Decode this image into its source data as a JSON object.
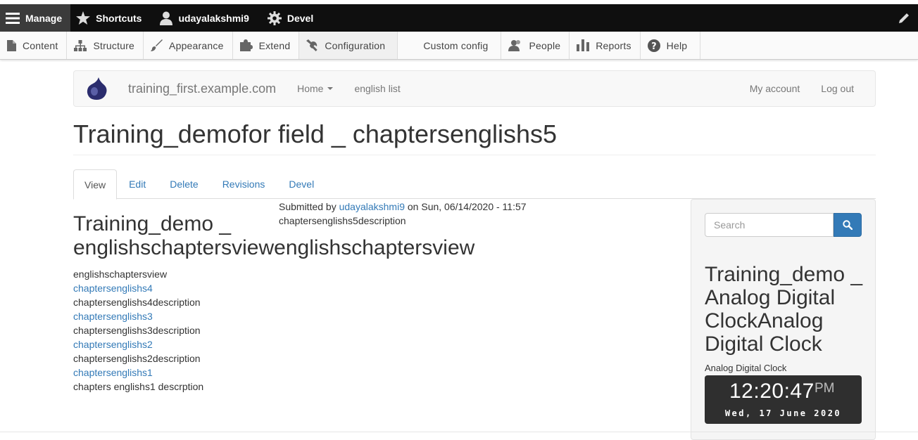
{
  "admin_toolbar": {
    "manage": "Manage",
    "shortcuts": "Shortcuts",
    "user": "udayalakshmi9",
    "devel": "Devel"
  },
  "admin_tray": [
    {
      "label": "Content",
      "icon": "file-icon"
    },
    {
      "label": "Structure",
      "icon": "sitemap-icon"
    },
    {
      "label": "Appearance",
      "icon": "paintbrush-icon"
    },
    {
      "label": "Extend",
      "icon": "puzzle-icon"
    },
    {
      "label": "Configuration",
      "icon": "wrench-icon"
    },
    {
      "label": "Custom config",
      "icon": ""
    },
    {
      "label": "People",
      "icon": "people-icon"
    },
    {
      "label": "Reports",
      "icon": "bar-chart-icon"
    },
    {
      "label": "Help",
      "icon": "help-icon"
    }
  ],
  "site_nav": {
    "site_name": "training_first.example.com",
    "home": "Home",
    "english_list": "english list",
    "my_account": "My account",
    "log_out": "Log out"
  },
  "page": {
    "title": "Training_demofor field _ chaptersenglishs5",
    "tabs": [
      "View",
      "Edit",
      "Delete",
      "Revisions",
      "Devel"
    ]
  },
  "view_block": {
    "title": "Training_demo _ englishschaptersviewenglishschaptersview",
    "header": "englishschaptersview",
    "items": [
      {
        "link": "chaptersenglishs4",
        "description": "chaptersenglishs4description"
      },
      {
        "link": "chaptersenglishs3",
        "description": "chaptersenglishs3description"
      },
      {
        "link": "chaptersenglishs2",
        "description": "chaptersenglishs2description"
      },
      {
        "link": "chaptersenglishs1",
        "description": "chapters englishs1 descrption"
      }
    ]
  },
  "node": {
    "submitted_prefix": "Submitted by",
    "author": "udayalakshmi9",
    "submitted_suffix": "on Sun, 06/14/2020 - 11:57",
    "body": "chaptersenglishs5description"
  },
  "sidebar": {
    "search_placeholder": "Search",
    "block_title": "Training_demo _ Analog Digital ClockAnalog Digital Clock",
    "block_label": "Analog Digital Clock",
    "clock_time": "12:20:47",
    "clock_ampm": "PM",
    "clock_date": "Wed, 17 June 2020"
  },
  "colors": {
    "link": "#337ab7",
    "toolbar": "#0f0f0f",
    "primary_button": "#337ab7"
  }
}
